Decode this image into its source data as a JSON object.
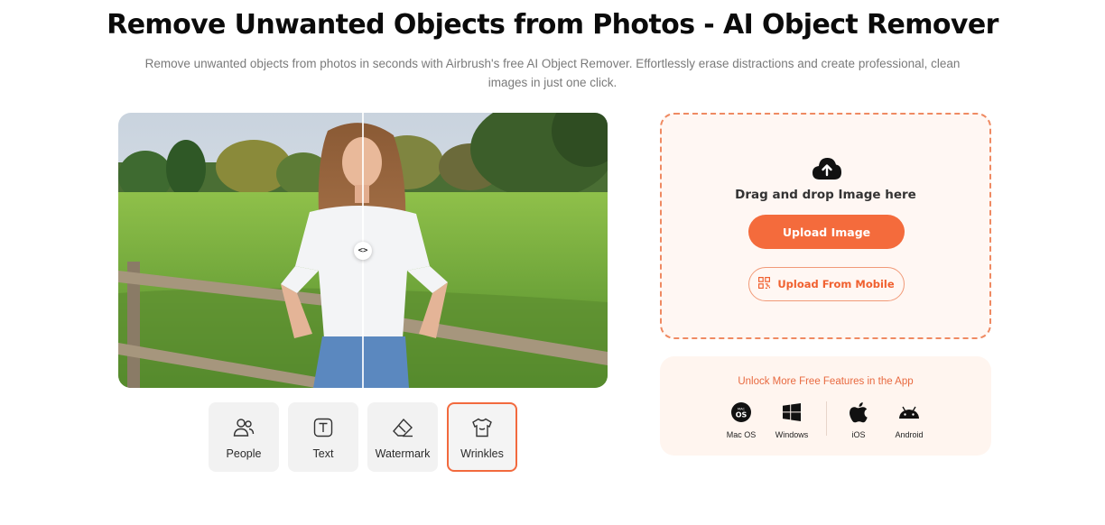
{
  "header": {
    "title": "Remove Unwanted Objects from Photos - AI Object Remover",
    "subtitle": "Remove unwanted objects from photos in seconds with Airbrush's free AI Object Remover. Effortlessly erase distractions and create professional, clean images in just one click."
  },
  "preview": {
    "divider_handle": "<>"
  },
  "categories": [
    {
      "label": "People",
      "icon": "people-icon",
      "active": false
    },
    {
      "label": "Text",
      "icon": "text-icon",
      "active": false
    },
    {
      "label": "Watermark",
      "icon": "eraser-icon",
      "active": false
    },
    {
      "label": "Wrinkles",
      "icon": "shirt-icon",
      "active": true
    }
  ],
  "upload": {
    "drag_text": "Drag and drop Image here",
    "upload_button": "Upload Image",
    "mobile_button": "Upload From Mobile"
  },
  "apps": {
    "title": "Unlock More Free Features in the App",
    "platforms": [
      {
        "label": "Mac OS",
        "icon": "macos-icon"
      },
      {
        "label": "Windows",
        "icon": "windows-icon"
      },
      {
        "label": "iOS",
        "icon": "apple-icon"
      },
      {
        "label": "Android",
        "icon": "android-icon"
      }
    ]
  },
  "colors": {
    "accent": "#f46b3c",
    "accent_text": "#e8693f",
    "upload_bg": "#fff7f3",
    "dashed_border": "#ef8a62"
  }
}
